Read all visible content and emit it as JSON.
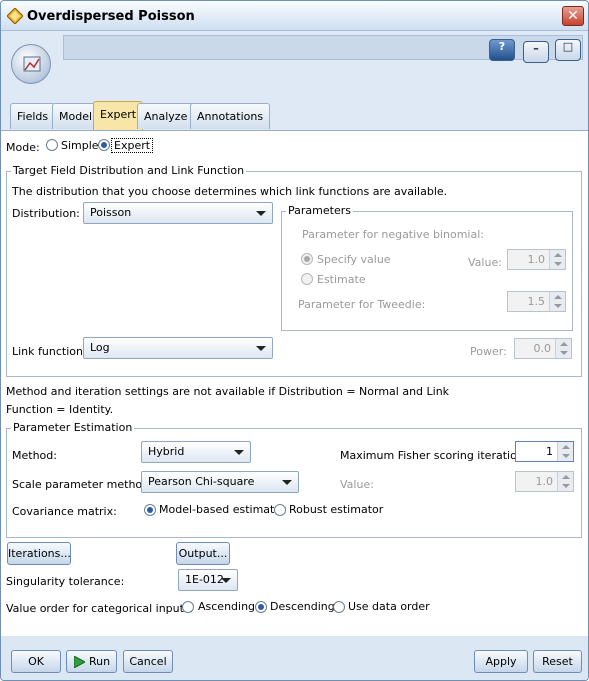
{
  "window": {
    "title": "Overdispersed Poisson",
    "close_glyph": "✕"
  },
  "header": {
    "help_glyph": "?",
    "minimize_glyph": "–",
    "maximize_glyph": "□"
  },
  "tabs": [
    {
      "label": "Fields"
    },
    {
      "label": "Model"
    },
    {
      "label": "Expert",
      "active": true
    },
    {
      "label": "Analyze"
    },
    {
      "label": "Annotations"
    }
  ],
  "mode": {
    "label": "Mode:",
    "simple": "Simple",
    "expert": "Expert",
    "selected": "Expert"
  },
  "target_group": {
    "legend": "Target Field Distribution and Link Function",
    "description": "The distribution that you choose determines which link functions are available.",
    "distribution_label": "Distribution:",
    "distribution_value": "Poisson",
    "link_label": "Link function:",
    "link_value": "Log",
    "power_label": "Power:",
    "power_value": "0.0",
    "parameters": {
      "legend": "Parameters",
      "neg_binomial_label": "Parameter for negative binomial:",
      "specify_value": "Specify value",
      "estimate": "Estimate",
      "value_label": "Value:",
      "value": "1.0",
      "tweedie_label": "Parameter for Tweedie:",
      "tweedie_value": "1.5"
    }
  },
  "note_line1": "Method and iteration settings are not available if Distribution = Normal and Link",
  "note_line2": "Function = Identity.",
  "estimation_group": {
    "legend": "Parameter Estimation",
    "method_label": "Method:",
    "method_value": "Hybrid",
    "fisher_label": "Maximum Fisher scoring iterations:",
    "fisher_value": "1",
    "scale_label": "Scale parameter method:",
    "scale_value": "Pearson Chi-square",
    "value_label": "Value:",
    "value": "1.0",
    "covariance_label": "Covariance matrix:",
    "model_based": "Model-based estimator",
    "robust": "Robust estimator"
  },
  "iterations_button": "Iterations...",
  "output_button": "Output...",
  "singularity": {
    "label": "Singularity tolerance:",
    "value": "1E-012"
  },
  "value_order": {
    "label": "Value order for categorical inputs:",
    "ascending": "Ascending",
    "descending": "Descending",
    "data_order": "Use data order"
  },
  "footer": {
    "ok": "OK",
    "run": "Run",
    "cancel": "Cancel",
    "apply": "Apply",
    "reset": "Reset"
  },
  "colors": {
    "accent": "#2e5aa8",
    "active_tab": "#f7e6a8",
    "title_bar": "#cfdff0"
  }
}
